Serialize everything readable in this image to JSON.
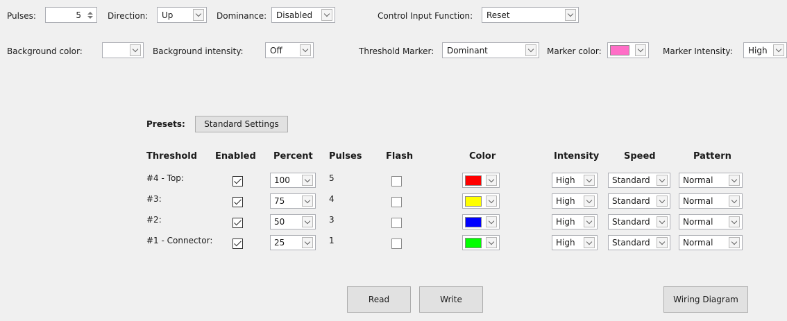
{
  "top": {
    "pulses_label": "Pulses:",
    "pulses_value": "5",
    "direction_label": "Direction:",
    "direction_value": "Up",
    "dominance_label": "Dominance:",
    "dominance_value": "Disabled",
    "control_label": "Control Input Function:",
    "control_value": "Reset",
    "bg_color_label": "Background color:",
    "bg_intensity_label": "Background intensity:",
    "bg_intensity_value": "Off",
    "threshold_marker_label": "Threshold Marker:",
    "threshold_marker_value": "Dominant",
    "marker_color_label": "Marker color:",
    "marker_color": "#ff6ec7",
    "marker_intensity_label": "Marker Intensity:",
    "marker_intensity_value": "High"
  },
  "presets": {
    "label": "Presets:",
    "button": "Standard Settings"
  },
  "table": {
    "headers": {
      "threshold": "Threshold",
      "enabled": "Enabled",
      "percent": "Percent",
      "pulses": "Pulses",
      "flash": "Flash",
      "color": "Color",
      "intensity": "Intensity",
      "speed": "Speed",
      "pattern": "Pattern"
    },
    "rows": [
      {
        "name": "#4 - Top:",
        "enabled": true,
        "percent": "100",
        "pulses": "5",
        "flash": false,
        "color": "#ff0000",
        "intensity": "High",
        "speed": "Standard",
        "pattern": "Normal"
      },
      {
        "name": "#3:",
        "enabled": true,
        "percent": "75",
        "pulses": "4",
        "flash": false,
        "color": "#ffff00",
        "intensity": "High",
        "speed": "Standard",
        "pattern": "Normal"
      },
      {
        "name": "#2:",
        "enabled": true,
        "percent": "50",
        "pulses": "3",
        "flash": false,
        "color": "#0000ff",
        "intensity": "High",
        "speed": "Standard",
        "pattern": "Normal"
      },
      {
        "name": "#1 - Connector:",
        "enabled": true,
        "percent": "25",
        "pulses": "1",
        "flash": false,
        "color": "#00ff00",
        "intensity": "High",
        "speed": "Standard",
        "pattern": "Normal"
      }
    ]
  },
  "buttons": {
    "read": "Read",
    "write": "Write",
    "wiring": "Wiring Diagram"
  }
}
